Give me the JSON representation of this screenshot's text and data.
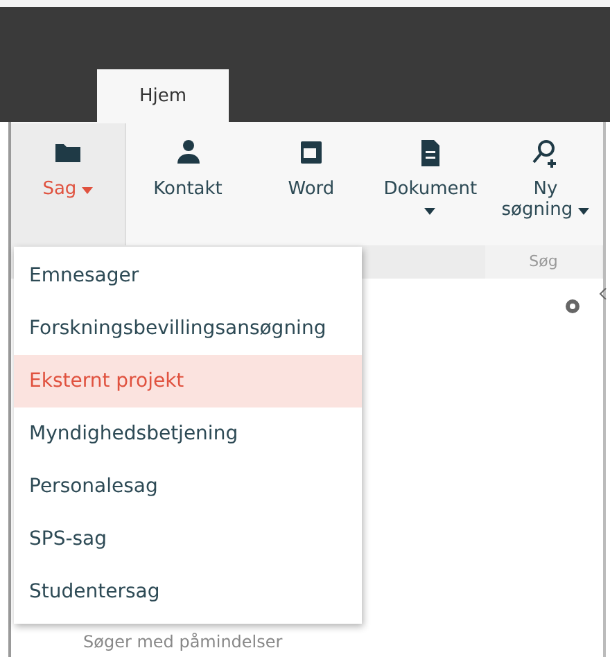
{
  "tabs": [
    {
      "label": "Hjem",
      "selected": true
    }
  ],
  "ribbon": {
    "buttons": [
      {
        "label": "Sag",
        "dropdown": true,
        "selected": true
      },
      {
        "label": "Kontakt",
        "dropdown": false,
        "selected": false
      },
      {
        "label": "Word",
        "dropdown": false,
        "selected": false
      },
      {
        "label": "Dokument",
        "dropdown": true,
        "selected": false
      },
      {
        "label": "Ny søgning",
        "dropdown": true,
        "selected": false
      }
    ],
    "group_label": "Søg"
  },
  "menu": {
    "items": [
      {
        "label": "Emnesager",
        "selected": false
      },
      {
        "label": "Forskningsbevillingsansøgning",
        "selected": false
      },
      {
        "label": "Eksternt projekt",
        "selected": true
      },
      {
        "label": "Myndighedsbetjening",
        "selected": false
      },
      {
        "label": "Personalesag",
        "selected": false
      },
      {
        "label": "SPS-sag",
        "selected": false
      },
      {
        "label": "Studentersag",
        "selected": false
      }
    ]
  },
  "content": {
    "hint": "Søger med påmindelser"
  }
}
